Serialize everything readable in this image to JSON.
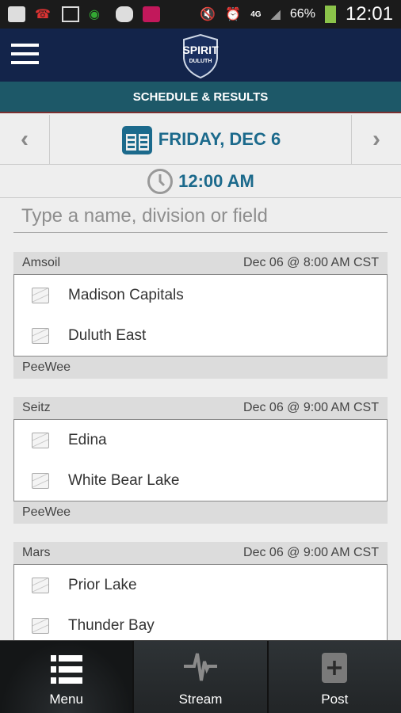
{
  "status_bar": {
    "battery": "66%",
    "time": "12:01"
  },
  "header": {
    "logo_text": "SPIRIT OF DULUTH",
    "title": "SCHEDULE & RESULTS"
  },
  "date_nav": {
    "date": "FRIDAY, DEC 6",
    "time": "12:00 AM"
  },
  "search": {
    "placeholder": "Type a name, division or field",
    "value": ""
  },
  "games": [
    {
      "field": "Amsoil",
      "datetime": "Dec 06 @ 8:00 AM CST",
      "teams": [
        "Madison Capitals",
        "Duluth East"
      ],
      "division": "PeeWee"
    },
    {
      "field": "Seitz",
      "datetime": "Dec 06 @ 9:00 AM CST",
      "teams": [
        "Edina",
        "White Bear Lake"
      ],
      "division": "PeeWee"
    },
    {
      "field": "Mars",
      "datetime": "Dec 06 @ 9:00 AM CST",
      "teams": [
        "Prior Lake",
        "Thunder Bay"
      ],
      "division": ""
    }
  ],
  "bottom_nav": {
    "items": [
      {
        "label": "Menu",
        "icon": "list-icon"
      },
      {
        "label": "Stream",
        "icon": "pulse-icon"
      },
      {
        "label": "Post",
        "icon": "plus-icon"
      }
    ]
  },
  "colors": {
    "header": "#13244a",
    "subbar": "#1d5868",
    "accent": "#1c6a8c"
  }
}
